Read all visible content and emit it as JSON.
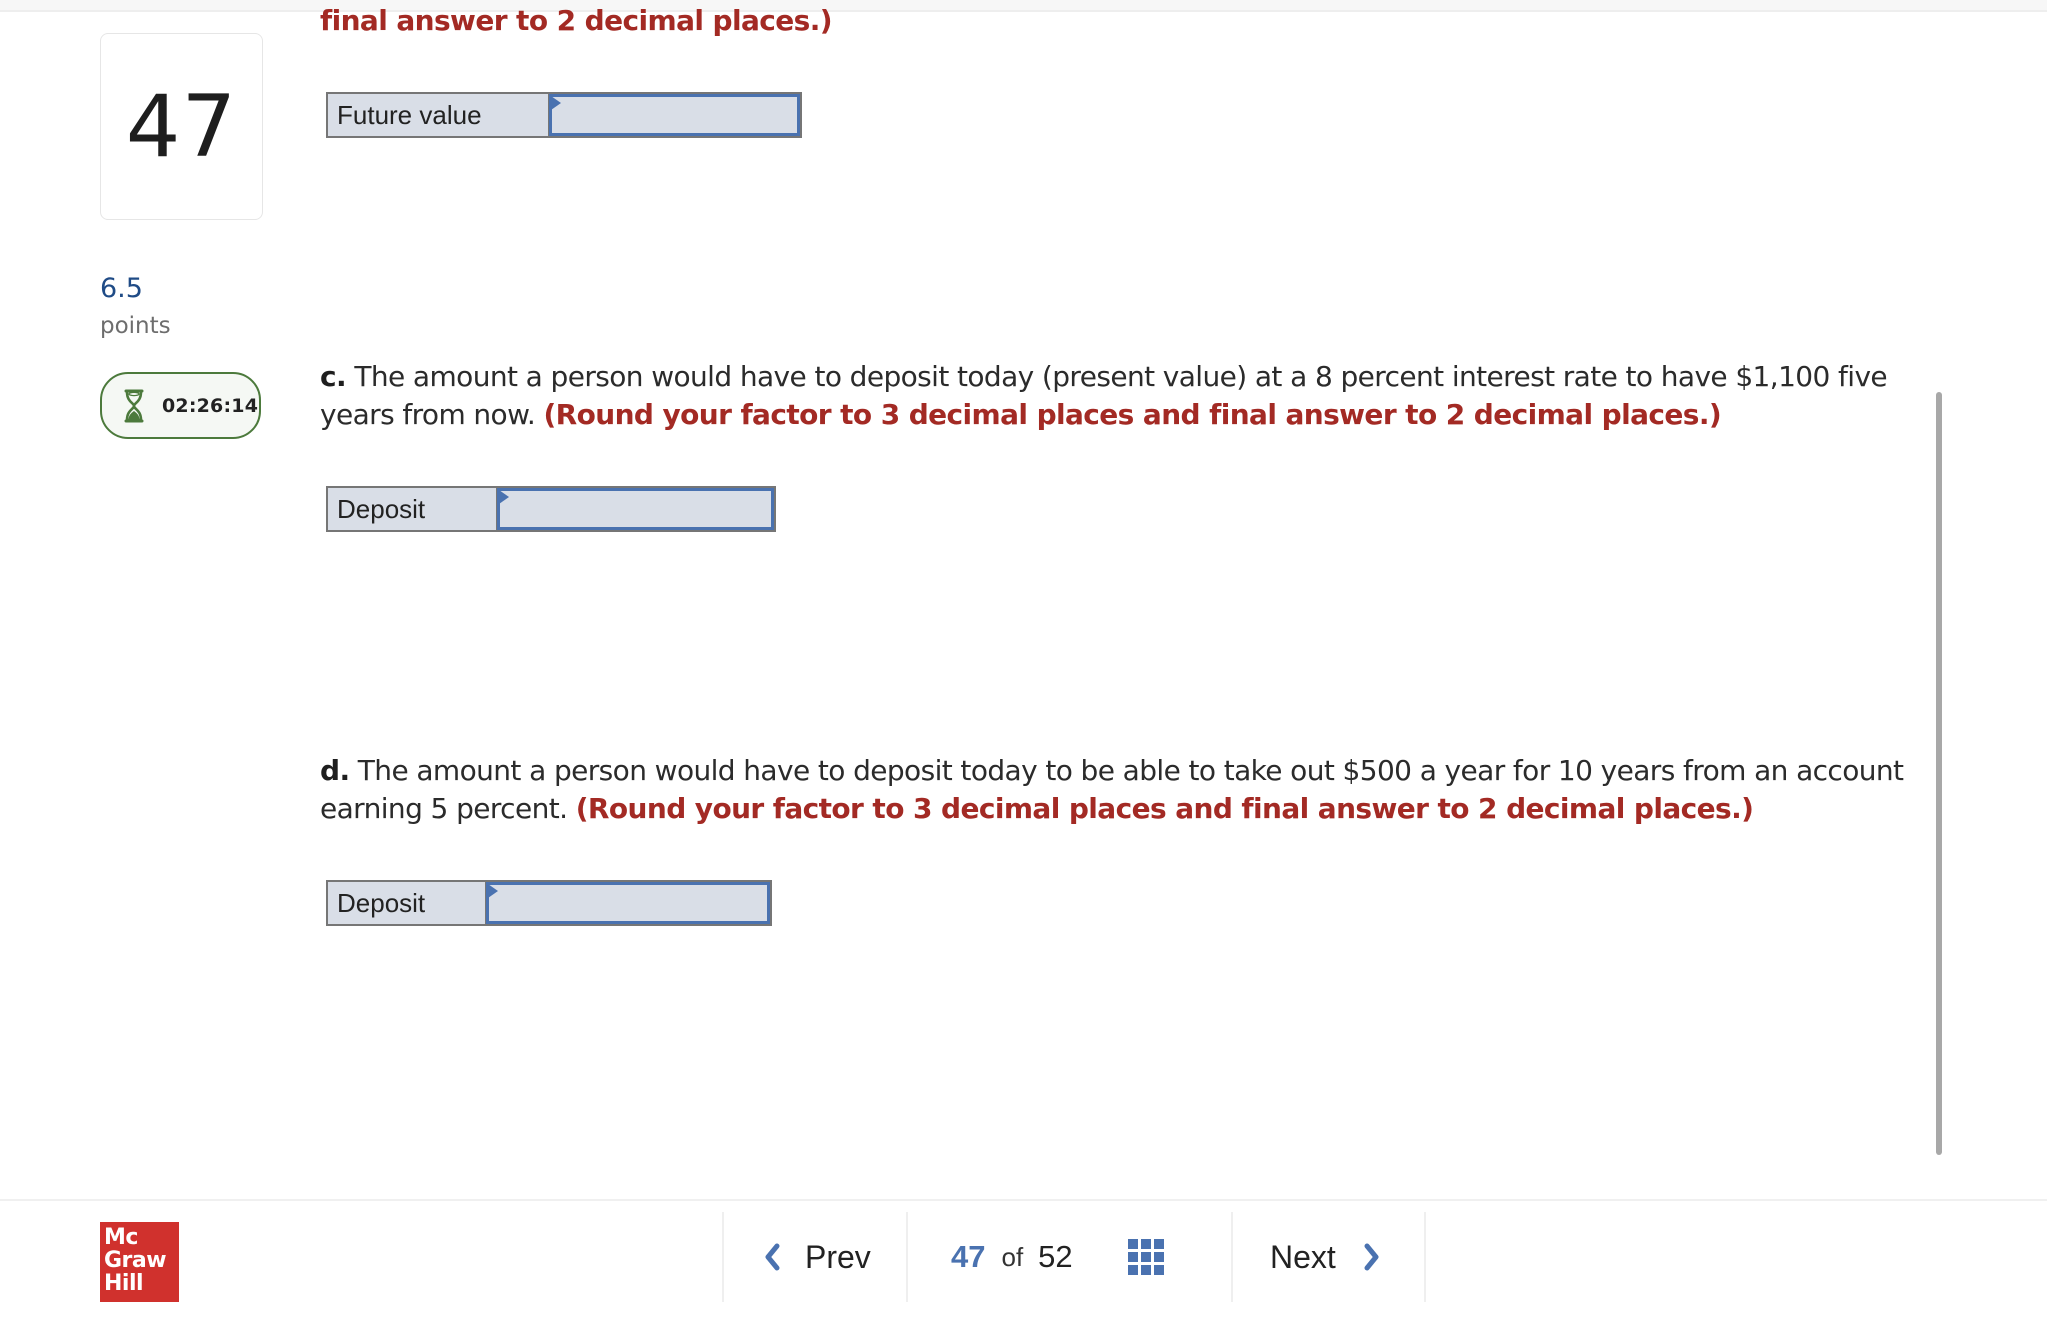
{
  "question": {
    "number": "47",
    "points_value": "6.5",
    "points_label": "points",
    "timer": "02:26:14"
  },
  "prior_text_tail": "final answer to 2 decimal places.)",
  "parts": [
    {
      "id": "b",
      "answer_label": "Future value",
      "answer_value": ""
    },
    {
      "id": "c",
      "prefix": "c.",
      "text": "The amount a person would have to deposit today (present value) at a 8 percent interest rate to have $1,100 five years from now.",
      "instruction": "(Round your factor to 3 decimal places and final answer to 2 decimal places.)",
      "answer_label": "Deposit",
      "answer_value": ""
    },
    {
      "id": "d",
      "prefix": "d.",
      "text": "The amount a person would have to deposit today to be able to take out $500 a year for 10 years from an account earning 5 percent.",
      "instruction": "(Round your factor to 3 decimal places and final answer to 2 decimal places.)",
      "answer_label": "Deposit",
      "answer_value": ""
    }
  ],
  "footer": {
    "logo_lines": [
      "Mc",
      "Graw",
      "Hill"
    ],
    "prev_label": "Prev",
    "next_label": "Next",
    "current_page": "47",
    "of_label": "of",
    "total_pages": "52"
  },
  "colors": {
    "instruction_red": "#a32a24",
    "accent_blue": "#4a72b0",
    "timer_green": "#4c7a3c",
    "logo_red": "#d0312d",
    "points_blue": "#1f4b86"
  }
}
